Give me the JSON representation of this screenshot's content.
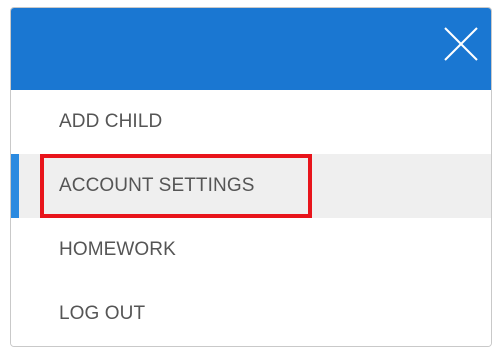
{
  "header": {
    "close_icon": "close-icon",
    "background_color": "#1a77d2"
  },
  "menu": {
    "items": [
      {
        "label": "ADD CHILD",
        "active": false
      },
      {
        "label": "ACCOUNT SETTINGS",
        "active": true
      },
      {
        "label": "HOMEWORK",
        "active": false
      },
      {
        "label": "LOG OUT",
        "active": false
      }
    ]
  },
  "colors": {
    "accent": "#2b8ae0",
    "highlight": "#e8141b",
    "text": "#555555"
  }
}
